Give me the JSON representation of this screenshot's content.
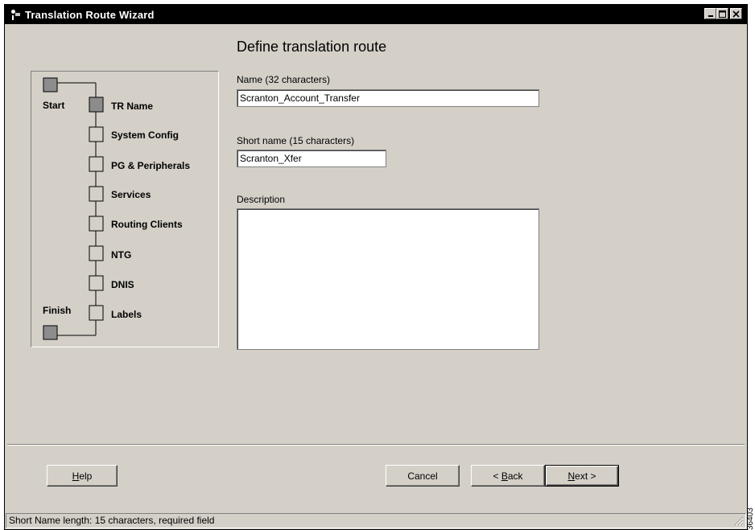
{
  "window": {
    "title": "Translation Route Wizard"
  },
  "page": {
    "heading": "Define translation route"
  },
  "steps": {
    "start_label": "Start",
    "finish_label": "Finish",
    "items": [
      {
        "label": "TR Name",
        "active": true
      },
      {
        "label": "System Config",
        "active": false
      },
      {
        "label": "PG & Peripherals",
        "active": false
      },
      {
        "label": "Services",
        "active": false
      },
      {
        "label": "Routing Clients",
        "active": false
      },
      {
        "label": "NTG",
        "active": false
      },
      {
        "label": "DNIS",
        "active": false
      },
      {
        "label": "Labels",
        "active": false
      }
    ]
  },
  "form": {
    "name_label": "Name (32 characters)",
    "name_value": "Scranton_Account_Transfer",
    "short_name_label": "Short name (15 characters)",
    "short_name_value": "Scranton_Xfer",
    "description_label": "Description",
    "description_value": ""
  },
  "buttons": {
    "help": "Help",
    "cancel": "Cancel",
    "back": "< Back",
    "next": "Next >"
  },
  "status": {
    "text": "Short Name length: 15 characters, required field"
  },
  "side_code": "36403",
  "colors": {
    "titlebar": "#000000",
    "face": "#d4d0c8",
    "step_active": "#8c8c8c"
  }
}
